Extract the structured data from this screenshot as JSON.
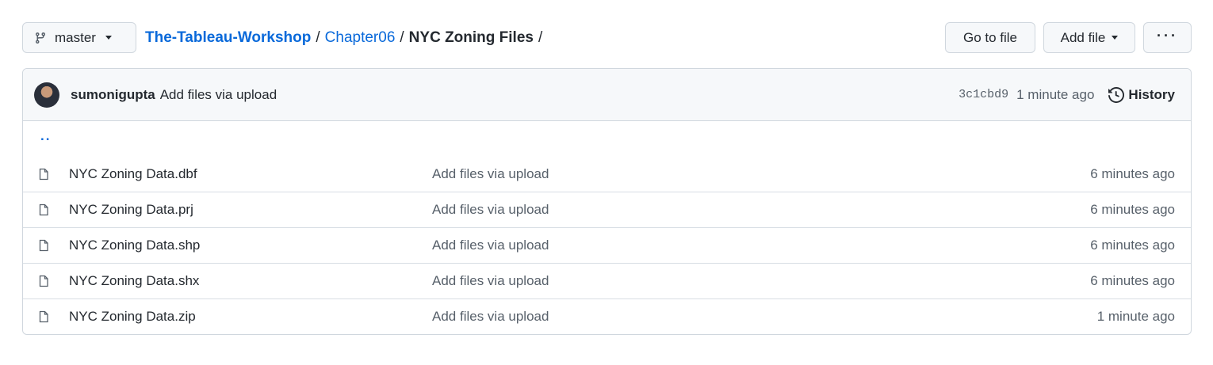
{
  "toolbar": {
    "branch": "master",
    "breadcrumb": {
      "repo": "The-Tableau-Workshop",
      "folder": "Chapter06",
      "current": "NYC Zoning Files",
      "separator": "/"
    },
    "goto_file": "Go to file",
    "add_file": "Add file",
    "more": "···"
  },
  "commit": {
    "user": "sumonigupta",
    "message": "Add files via upload",
    "sha": "3c1cbd9",
    "time": "1 minute ago",
    "history_label": "History"
  },
  "parent_dir": "..",
  "files": [
    {
      "name": "NYC Zoning Data.dbf",
      "commit": "Add files via upload",
      "age": "6 minutes ago"
    },
    {
      "name": "NYC Zoning Data.prj",
      "commit": "Add files via upload",
      "age": "6 minutes ago"
    },
    {
      "name": "NYC Zoning Data.shp",
      "commit": "Add files via upload",
      "age": "6 minutes ago"
    },
    {
      "name": "NYC Zoning Data.shx",
      "commit": "Add files via upload",
      "age": "6 minutes ago"
    },
    {
      "name": "NYC Zoning Data.zip",
      "commit": "Add files via upload",
      "age": "1 minute ago"
    }
  ],
  "icons": {
    "branch": "git-branch-icon",
    "file": "file-icon",
    "history": "history-clock-icon",
    "caret": "chevron-down-icon"
  },
  "colors": {
    "link": "#0969da",
    "text": "#24292f",
    "muted": "#57606a",
    "border": "#d0d7de",
    "header_bg": "#f6f8fa"
  }
}
